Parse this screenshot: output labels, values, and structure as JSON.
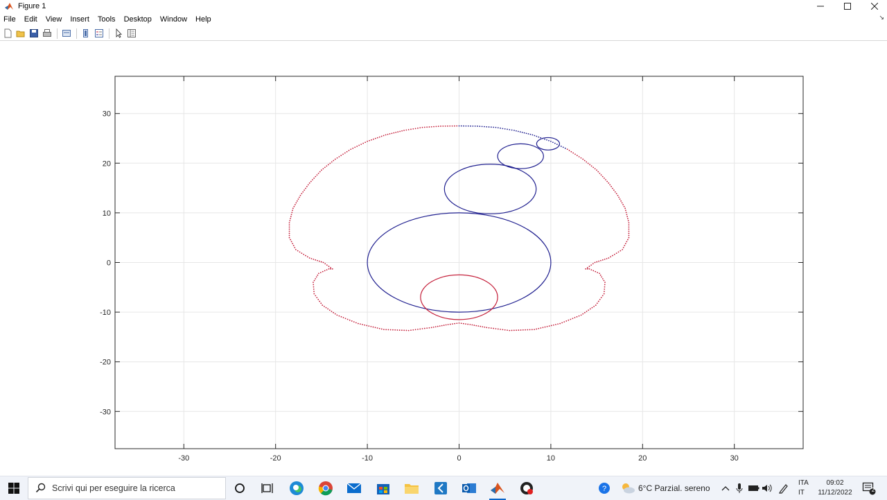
{
  "window": {
    "title": "Figure 1"
  },
  "menu": [
    "File",
    "Edit",
    "View",
    "Insert",
    "Tools",
    "Desktop",
    "Window",
    "Help"
  ],
  "toolbar_icons": [
    "new-figure-icon",
    "open-file-icon",
    "save-icon",
    "print-icon",
    "print-preview-icon",
    "colorbar-icon",
    "legend-icon",
    "edit-plot-icon",
    "property-editor-icon"
  ],
  "chart_data": {
    "type": "line",
    "title": "",
    "xlabel": "",
    "ylabel": "",
    "xlim": [
      -37.5,
      37.5
    ],
    "ylim": [
      -37.5,
      37.5
    ],
    "grid": true,
    "xticks": [
      -30,
      -20,
      -10,
      0,
      10,
      20,
      30
    ],
    "yticks": [
      -30,
      -20,
      -10,
      0,
      10,
      20,
      30
    ],
    "xtick_labels": [
      "-30",
      "-20",
      "-10",
      "0",
      "10",
      "20",
      "30"
    ],
    "ytick_labels": [
      "-30",
      "-20",
      "-10",
      "0",
      "10",
      "20",
      "30"
    ],
    "circles": [
      {
        "color": "#1f1f8f",
        "cx": 0.0,
        "cy": 0.0,
        "rx": 10.0,
        "ry": 10.0
      },
      {
        "color": "#1f1f8f",
        "cx": 3.4,
        "cy": 14.8,
        "rx": 5.0,
        "ry": 5.0
      },
      {
        "color": "#1f1f8f",
        "cx": 6.7,
        "cy": 21.4,
        "rx": 2.5,
        "ry": 2.5
      },
      {
        "color": "#1f1f8f",
        "cx": 9.7,
        "cy": 23.9,
        "rx": 1.25,
        "ry": 1.25
      },
      {
        "color": "#c41f3a",
        "cx": 0.0,
        "cy": -7.0,
        "rx": 4.2,
        "ry": 4.5
      }
    ],
    "trace_color": "#c41f3a",
    "trace_color_top": "#1f1f8f",
    "trace_points_right": [
      [
        0.0,
        27.5
      ],
      [
        2.0,
        27.45
      ],
      [
        4.0,
        27.2
      ],
      [
        6.0,
        26.6
      ],
      [
        8.0,
        25.7
      ],
      [
        10.0,
        24.4
      ],
      [
        11.8,
        22.8
      ],
      [
        13.5,
        20.8
      ],
      [
        15.0,
        18.6
      ],
      [
        16.3,
        16.0
      ],
      [
        17.3,
        13.5
      ],
      [
        18.1,
        10.9
      ],
      [
        18.5,
        8.0
      ],
      [
        18.5,
        5.0
      ],
      [
        17.8,
        2.6
      ],
      [
        16.3,
        0.9
      ],
      [
        14.8,
        0.0
      ],
      [
        13.8,
        -1.3
      ],
      [
        14.2,
        -1.3
      ],
      [
        15.3,
        -2.2
      ],
      [
        15.9,
        -4.0
      ],
      [
        15.8,
        -6.3
      ],
      [
        14.9,
        -8.6
      ],
      [
        13.3,
        -10.6
      ],
      [
        11.0,
        -12.3
      ],
      [
        8.2,
        -13.5
      ],
      [
        5.5,
        -13.7
      ],
      [
        3.0,
        -13.1
      ],
      [
        1.2,
        -12.5
      ],
      [
        0.0,
        -12.2
      ]
    ]
  },
  "taskbar": {
    "search_placeholder": "Scrivi qui per eseguire la ricerca",
    "weather": "6°C  Parzial. sereno",
    "language_top": "ITA",
    "language_bottom": "IT",
    "time": "09:02",
    "date": "11/12/2022",
    "notification_count": "2",
    "apps": [
      "cortana-circle-icon",
      "task-view-icon",
      "edge-icon",
      "chrome-icon",
      "mail-icon",
      "store-icon",
      "file-explorer-icon",
      "vscode-icon",
      "outlook-icon",
      "matlab-icon",
      "recorder-icon"
    ]
  }
}
